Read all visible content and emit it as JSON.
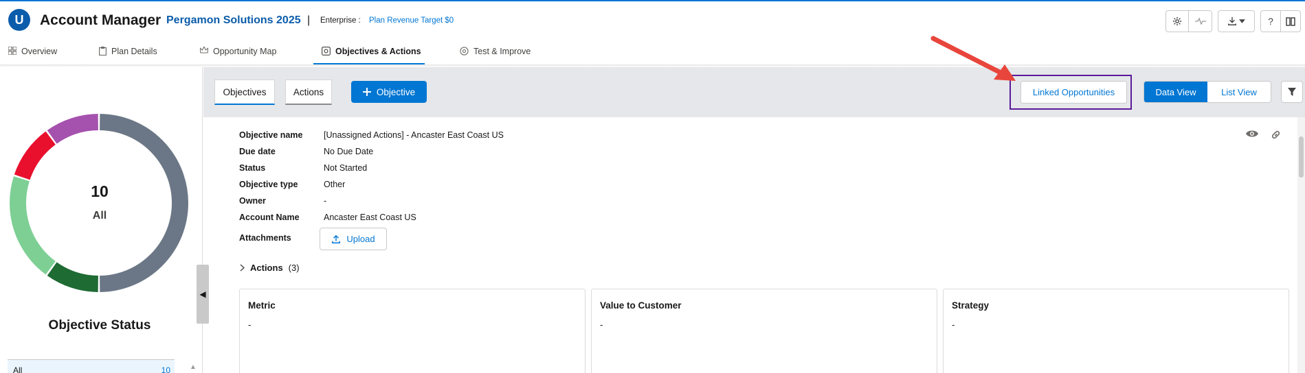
{
  "header": {
    "logo_letter": "U",
    "app_title": "Account Manager",
    "plan_name": "Pergamon Solutions 2025",
    "separator": "|",
    "enterprise_label": "Enterprise :",
    "plan_revenue_target": "Plan Revenue Target $0",
    "icons": [
      "settings-icon",
      "pulse-icon",
      "download-icon",
      "chevron-down-icon",
      "help-icon",
      "book-icon"
    ],
    "help_glyph": "?"
  },
  "tabs": [
    {
      "label": "Overview",
      "icon": "grid-icon",
      "active": false
    },
    {
      "label": "Plan Details",
      "icon": "clipboard-icon",
      "active": false
    },
    {
      "label": "Opportunity Map",
      "icon": "crown-icon",
      "active": false
    },
    {
      "label": "Objectives & Actions",
      "icon": "target-icon",
      "active": true
    },
    {
      "label": "Test & Improve",
      "icon": "atom-icon",
      "active": false
    }
  ],
  "left_panel": {
    "total_count": "10",
    "total_label": "All",
    "title": "Objective Status",
    "filter_label": "All",
    "filter_count": "10",
    "segments_colors": [
      "#6b7786",
      "#1e6b34",
      "#7ecf94",
      "#e8102d",
      "#a551ae"
    ]
  },
  "toolbar": {
    "objectives_label": "Objectives",
    "actions_label": "Actions",
    "add_objective_label": "Objective",
    "linked_opportunities_label": "Linked Opportunities",
    "data_view_label": "Data View",
    "list_view_label": "List View"
  },
  "details": {
    "fields": [
      {
        "label": "Objective name",
        "value": "[Unassigned Actions] - Ancaster East Coast US"
      },
      {
        "label": "Due date",
        "value": "No Due Date"
      },
      {
        "label": "Status",
        "value": "Not Started"
      },
      {
        "label": "Objective type",
        "value": "Other"
      },
      {
        "label": "Owner",
        "value": "-"
      },
      {
        "label": "Account Name",
        "value": "Ancaster East Coast US"
      }
    ],
    "attachments_label": "Attachments",
    "upload_label": "Upload",
    "actions_label": "Actions",
    "actions_count": "(3)"
  },
  "cards": [
    {
      "title": "Metric",
      "value": "-"
    },
    {
      "title": "Value to Customer",
      "value": "-"
    },
    {
      "title": "Strategy",
      "value": "-"
    }
  ],
  "colors": {
    "brand_blue": "#0176d3",
    "highlight_purple": "#5a1a9a",
    "arrow_red": "#e8453c"
  }
}
